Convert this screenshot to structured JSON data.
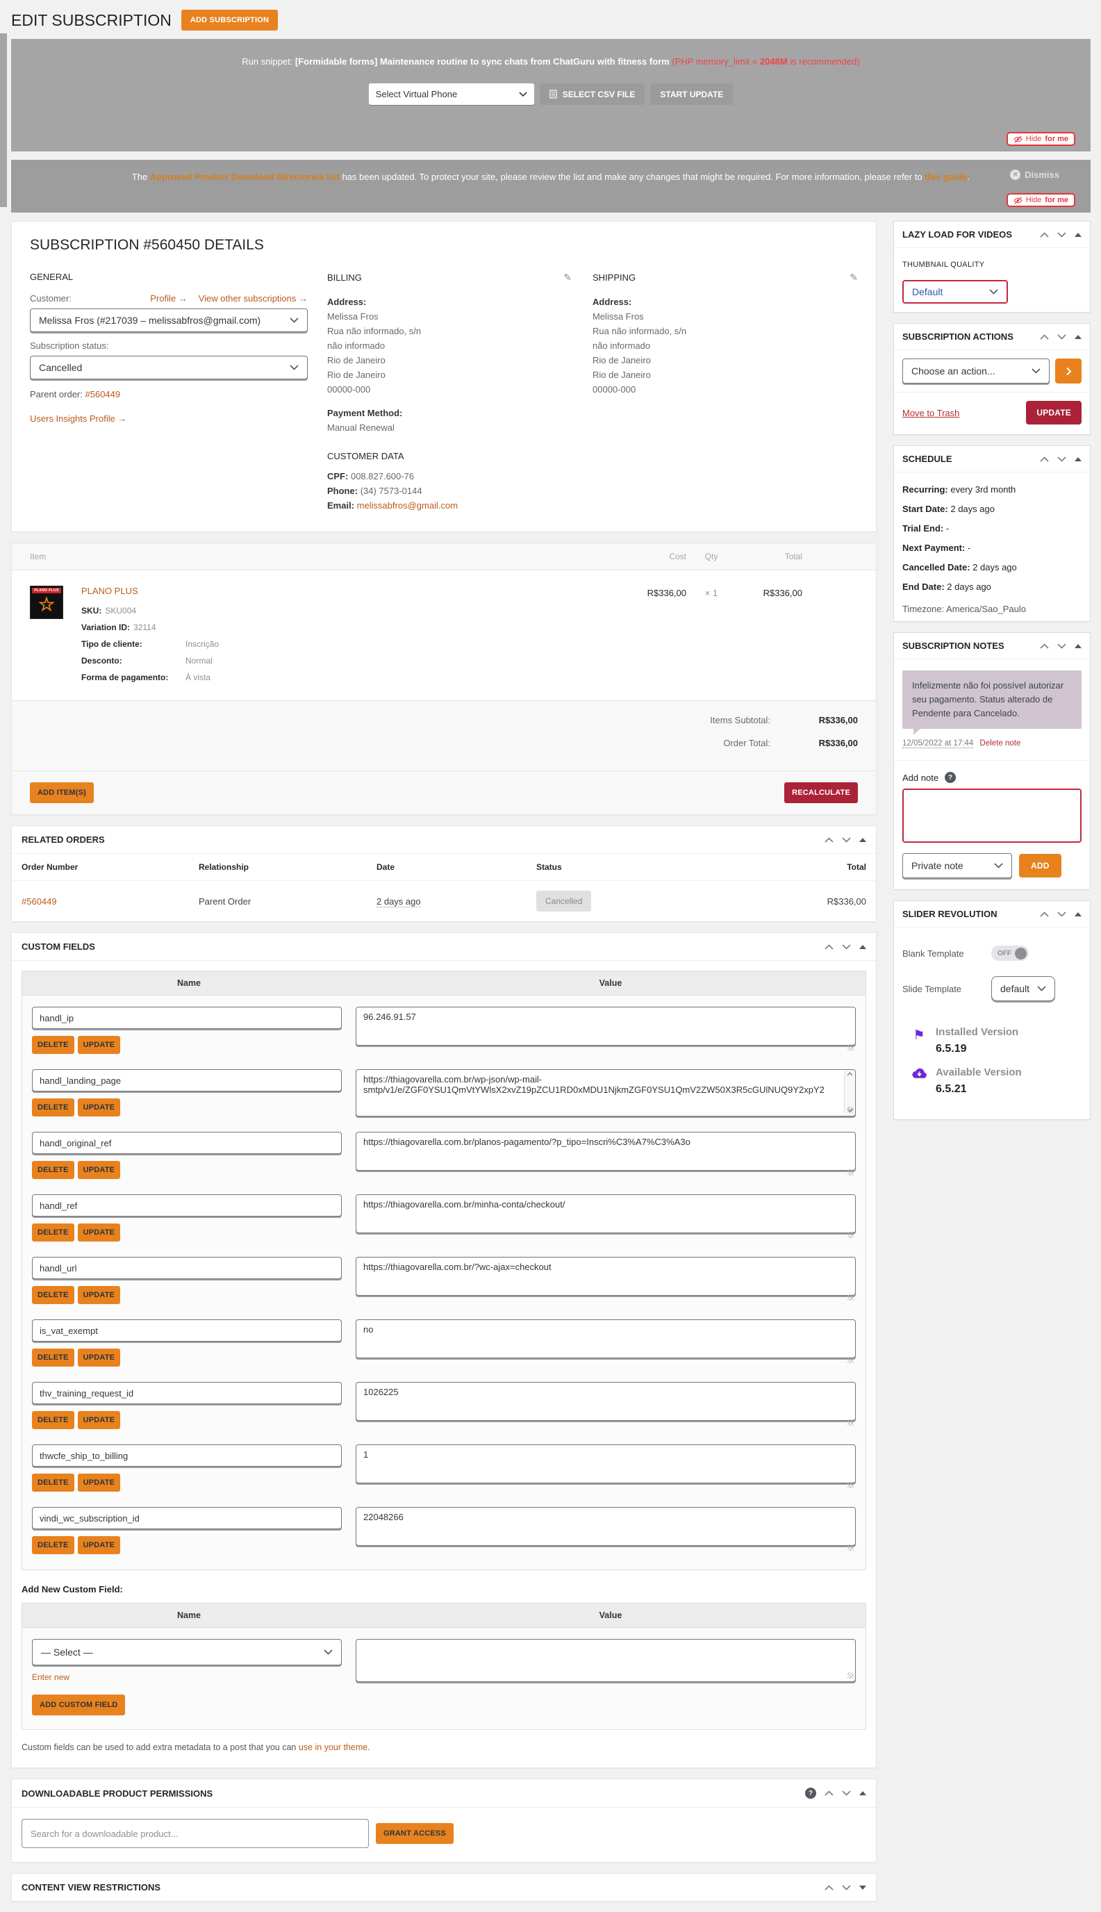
{
  "colors": {
    "accent_orange": "#e8821e",
    "crimson": "#ab2239",
    "link_orange": "#b85c1c",
    "alert_red": "#ee4549",
    "banner_gray": "#a5a5a5",
    "banner_gray_2": "#9d9d9d",
    "note_bubble": "#d0c4d0",
    "red_border": "#c5283c",
    "purple": "#6d28d9"
  },
  "icons": {
    "edit": "pencil-icon",
    "hide": "eye-slash-icon",
    "dismiss": "circle-x-icon",
    "help": "question-circle-icon",
    "sort_up": "chevron-up-icon",
    "sort_down": "chevron-down-icon",
    "collapse": "triangle-icon",
    "csv": "document-icon",
    "go": "chevron-right-icon",
    "flag": "flag-icon",
    "download": "cloud-download-icon",
    "star": "star-outline-icon"
  },
  "hide_button": {
    "pre": "Hide",
    "bold": "for me"
  },
  "page": {
    "title": "EDIT SUBSCRIPTION",
    "add_button": "ADD SUBSCRIPTION"
  },
  "banner1": {
    "prefix": "Run snippet: ",
    "bold": "[Formidable forms] Maintenance routine to sync chats from ChatGuru with fitness form",
    "warn_pre": " (PHP memory_limit = ",
    "warn_bold": "2048M",
    "warn_post": " is recommended)",
    "select_value": "Select Virtual Phone",
    "csv_button": "SELECT CSV FILE",
    "start_button": "START UPDATE"
  },
  "banner2": {
    "pre": "The ",
    "link1": "Approved Product Download Directories list",
    "mid": " has been updated. To protect your site, please review the list and make any changes that might be required. For more information, please refer to ",
    "link2": "this guide",
    "post": ".",
    "dismiss": "Dismiss"
  },
  "details": {
    "title": "SUBSCRIPTION #560450 DETAILS",
    "general": {
      "heading": "GENERAL",
      "customer_label": "Customer:",
      "profile_link": "Profile →",
      "other_link": "View other subscriptions →",
      "customer_value": "Melissa Fros (#217039 – melissabfros@gmail.com)",
      "status_label": "Subscription status:",
      "status_value": "Cancelled",
      "parent_label": "Parent order: ",
      "parent_link": "#560449",
      "insights_link": "Users Insights Profile →"
    },
    "billing": {
      "heading": "BILLING",
      "address_label": "Address:",
      "lines": [
        "Melissa Fros",
        "Rua não informado, s/n",
        "não informado",
        "Rio de Janeiro",
        "Rio de Janeiro",
        "00000-000"
      ],
      "payment_label": "Payment Method:",
      "payment_value": "Manual Renewal",
      "customer_data_heading": "CUSTOMER DATA",
      "cpf_label": "CPF:",
      "cpf_value": "008.827.600-76",
      "phone_label": "Phone:",
      "phone_value": "(34) 7573-0144",
      "email_label": "Email:",
      "email_value": "melissabfros@gmail.com"
    },
    "shipping": {
      "heading": "SHIPPING",
      "address_label": "Address:",
      "lines": [
        "Melissa Fros",
        "Rua não informado, s/n",
        "não informado",
        "Rio de Janeiro",
        "Rio de Janeiro",
        "00000-000"
      ]
    }
  },
  "items": {
    "head": {
      "item": "Item",
      "cost": "Cost",
      "qty": "Qty",
      "total": "Total"
    },
    "product": {
      "thumb_caption": "PLANO PLUS",
      "name": "PLANO PLUS",
      "sku_label": "SKU:",
      "sku": "SKU004",
      "variation_label": "Variation ID:",
      "variation": "32114",
      "meta": [
        {
          "label": "Tipo de cliente:",
          "value": "Inscrição"
        },
        {
          "label": "Desconto:",
          "value": "Normal"
        },
        {
          "label": "Forma de pagamento:",
          "value": "À vista"
        }
      ],
      "cost": "R$336,00",
      "qty": "× 1",
      "total": "R$336,00"
    },
    "subtotal_label": "Items Subtotal:",
    "subtotal": "R$336,00",
    "total_label": "Order Total:",
    "total": "R$336,00",
    "add_items_button": "ADD ITEM(S)",
    "recalculate_button": "RECALCULATE"
  },
  "related": {
    "title": "RELATED ORDERS",
    "headers": {
      "number": "Order Number",
      "relationship": "Relationship",
      "date": "Date",
      "status": "Status",
      "total": "Total"
    },
    "row": {
      "number": "#560449",
      "relationship": "Parent Order",
      "date": "2 days ago",
      "status": "Cancelled",
      "total": "R$336,00"
    }
  },
  "custom_fields": {
    "title": "CUSTOM FIELDS",
    "name_header": "Name",
    "value_header": "Value",
    "delete": "DELETE",
    "update": "UPDATE",
    "rows": [
      {
        "name": "handl_ip",
        "value": "96.246.91.57"
      },
      {
        "name": "handl_landing_page",
        "value": "https://thiagovarella.com.br/wp-json/wp-mail-smtp/v1/e/ZGF0YSU1QmVtYWlsX2xvZ19pZCU1RD0xMDU1NjkmZGF0YSU1QmV2ZW50X3R5cGUlNUQ9Y2xpY2"
      },
      {
        "name": "handl_original_ref",
        "value": "https://thiagovarella.com.br/planos-pagamento/?p_tipo=Inscri%C3%A7%C3%A3o"
      },
      {
        "name": "handl_ref",
        "value": "https://thiagovarella.com.br/minha-conta/checkout/"
      },
      {
        "name": "handl_url",
        "value": "https://thiagovarella.com.br/?wc-ajax=checkout"
      },
      {
        "name": "is_vat_exempt",
        "value": "no"
      },
      {
        "name": "thv_training_request_id",
        "value": "1026225"
      },
      {
        "name": "thwcfe_ship_to_billing",
        "value": "1"
      },
      {
        "name": "vindi_wc_subscription_id",
        "value": "22048266"
      }
    ],
    "add_new_label": "Add New Custom Field:",
    "select_value": "— Select —",
    "enter_new": "Enter new",
    "add_button": "ADD CUSTOM FIELD",
    "foot_pre": "Custom fields can be used to add extra metadata to a post that you can ",
    "foot_link": "use in your theme",
    "foot_post": "."
  },
  "downloadable": {
    "title": "DOWNLOADABLE PRODUCT PERMISSIONS",
    "placeholder": "Search for a downloadable product...",
    "grant_button": "GRANT ACCESS"
  },
  "content_view": {
    "title": "CONTENT VIEW RESTRICTIONS"
  },
  "sidebar": {
    "lazy": {
      "title": "LAZY LOAD FOR VIDEOS",
      "quality_label": "THUMBNAIL QUALITY",
      "quality_value": "Default"
    },
    "actions": {
      "title": "SUBSCRIPTION ACTIONS",
      "select_value": "Choose an action...",
      "trash_link": "Move to Trash",
      "update_button": "UPDATE"
    },
    "schedule": {
      "title": "SCHEDULE",
      "rows": [
        {
          "label": "Recurring: ",
          "value": "every 3rd month"
        },
        {
          "label": "Start Date: ",
          "value": "2 days ago"
        },
        {
          "label": "Trial End: ",
          "value": "-"
        },
        {
          "label": "Next Payment: ",
          "value": "-"
        },
        {
          "label": "Cancelled Date: ",
          "value": "2 days ago"
        },
        {
          "label": "End Date: ",
          "value": "2 days ago"
        }
      ],
      "timezone": "Timezone: America/Sao_Paulo"
    },
    "notes": {
      "title": "SUBSCRIPTION NOTES",
      "note": "Infelizmente não foi possível autorizar seu pagamento. Status alterado de Pendente para Cancelado.",
      "date": "12/05/2022 at 17:44",
      "delete_link": "Delete note",
      "add_label": "Add note",
      "type_value": "Private note",
      "add_button": "ADD"
    },
    "slider": {
      "title": "SLIDER REVOLUTION",
      "blank_label": "Blank Template",
      "toggle": "OFF",
      "slide_label": "Slide Template",
      "slide_value": "default",
      "installed_label": "Installed Version",
      "installed_version": "6.5.19",
      "available_label": "Available Version",
      "available_version": "6.5.21"
    }
  }
}
